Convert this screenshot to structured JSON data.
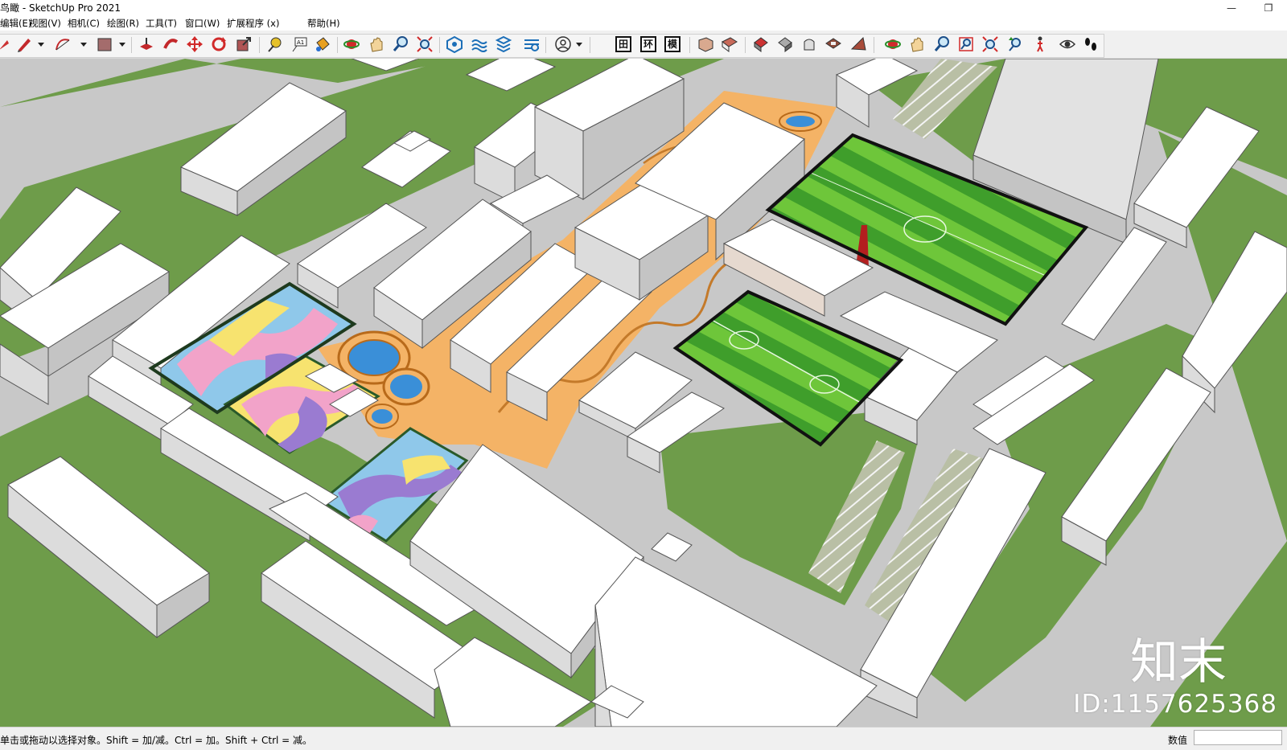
{
  "window": {
    "title": "鸟瞰 - SketchUp Pro 2021",
    "buttons": [
      "—",
      "❐"
    ]
  },
  "menu": [
    {
      "label": "编辑(E)"
    },
    {
      "label": "视图(V)"
    },
    {
      "label": "相机(C)"
    },
    {
      "label": "绘图(R)"
    },
    {
      "label": "工具(T)"
    },
    {
      "label": "窗口(W)"
    },
    {
      "label": "扩展程序 (x)"
    },
    {
      "label": "帮助(H)"
    }
  ],
  "toolbar": {
    "text_buttons": [
      "田",
      "环",
      "模"
    ],
    "icons": [
      "arrow-dropdown-icon",
      "pencil-icon",
      "arc-icon",
      "rectangle-icon",
      "push-pull-icon",
      "follow-me-icon",
      "move-icon",
      "rotate-icon",
      "scale-icon",
      "tape-measure-icon",
      "text-label-icon",
      "paint-bucket-icon",
      "orbit-icon",
      "pan-icon",
      "zoom-icon",
      "zoom-extents-icon",
      "sandbox-icon",
      "sandbox-smoove-icon",
      "sandbox-stamp-icon",
      "sandbox-flip-icon",
      "user-icon",
      "plugin-icon",
      "iso-view-icon",
      "top-view-icon",
      "front-view-icon",
      "right-view-icon",
      "back-view-icon",
      "left-view-icon",
      "orbit-icon-2",
      "pan-icon-2",
      "zoom-icon-2",
      "zoom-window-icon",
      "zoom-extents-icon-2",
      "previous-view-icon",
      "walk-icon",
      "look-around-icon",
      "footprints-icon"
    ]
  },
  "viewport": {
    "watermark_id": "ID:1157625368",
    "watermark_logo": "知末",
    "colors": {
      "grass": "#6e9c4a",
      "road": "#c8c8c8",
      "plaza": "#f4b366",
      "building": "#ffffff",
      "pitch_dark": "#3f9e2b",
      "pitch_light": "#6ec63a",
      "court_pink": "#f2a3c9",
      "court_yellow": "#f7e36f",
      "court_blue": "#8fc8ea",
      "court_purple": "#9a7bd1",
      "chimney": "#b31f1f"
    }
  },
  "status": {
    "message": "单击或拖动以选择对象。Shift = 加/减。Ctrl = 加。Shift + Ctrl = 减。",
    "vcb_label": "数值",
    "vcb_value": ""
  }
}
